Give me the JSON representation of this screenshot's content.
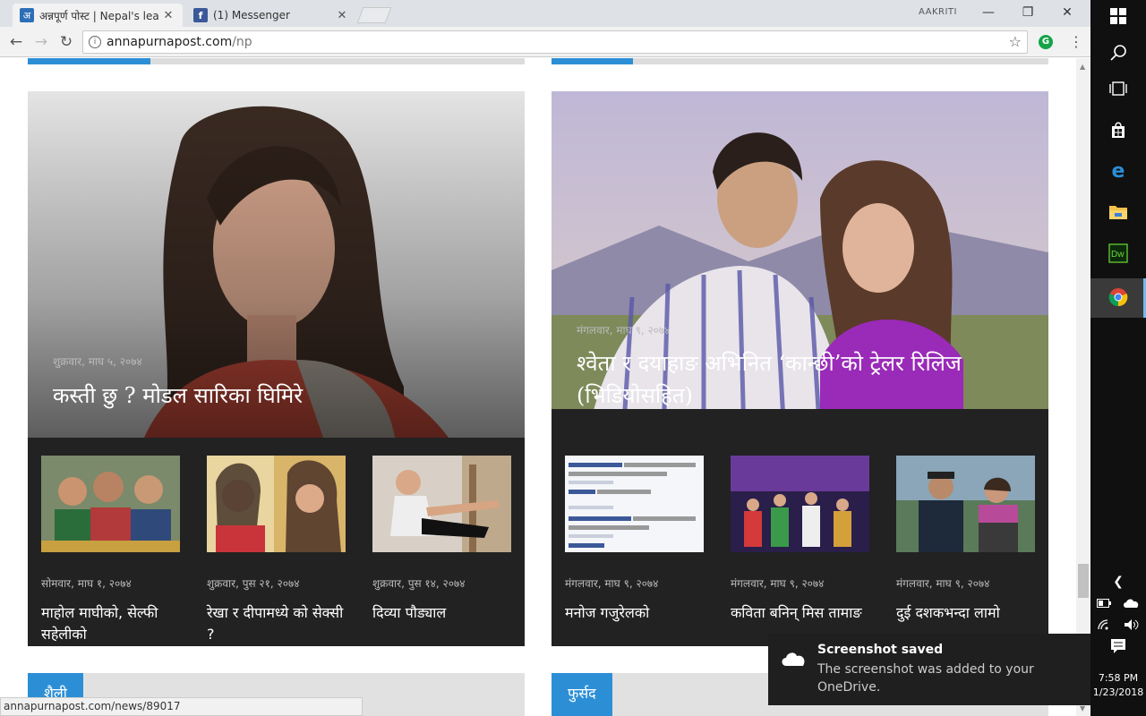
{
  "browser": {
    "tabs": [
      {
        "title": "अन्नपूर्ण पोस्ट | Nepal's lea",
        "favicon": "अ",
        "close": "✕"
      },
      {
        "title": "(1) Messenger",
        "favicon": "f",
        "close": "✕"
      }
    ],
    "user": "AAKRITI",
    "url_host": "annapurnapost.com",
    "url_path": "/np",
    "status_url": "annapurnapost.com/news/89017"
  },
  "left_panel": {
    "hero": {
      "date": "शुक्रवार, माघ ५, २०७४",
      "headline": "कस्ती छु ? मोडल सारिका घिमिरे"
    },
    "thumbs": [
      {
        "date": "सोमवार, माघ १, २०७४",
        "title": "माहोल माघीको, सेल्फी सहेलीको"
      },
      {
        "date": "शुक्रवार, पुस २१, २०७४",
        "title": "रेखा र दीपामध्ये को सेक्सी ?"
      },
      {
        "date": "शुक्रवार, पुस १४, २०७४",
        "title": "दिव्या पौड्याल"
      }
    ],
    "section_label": "शैली"
  },
  "right_panel": {
    "hero": {
      "date": "मंगलवार, माघ ९, २०७४",
      "headline": "श्वेता र दयाहाङ अभिनित ‘कान्छी’को ट्रेलर रिलिज (भिडियोसहित)"
    },
    "thumbs": [
      {
        "date": "मंगलवार, माघ ९, २०७४",
        "title": "मनोज गजुरेलको"
      },
      {
        "date": "मंगलवार, माघ ९, २०७४",
        "title": "कविता बनिन् मिस तामाङ"
      },
      {
        "date": "मंगलवार, माघ ९, २०७४",
        "title": "दुई दशकभन्दा लामो"
      }
    ],
    "section_label": "फुर्सद"
  },
  "toast": {
    "title": "Screenshot saved",
    "message": "The screenshot was added to your OneDrive."
  },
  "clock": {
    "time": "7:58 PM",
    "date": "1/23/2018"
  },
  "colors": {
    "accent": "#2c8fd6",
    "panel_bg": "#222222",
    "taskbar": "#101010"
  }
}
